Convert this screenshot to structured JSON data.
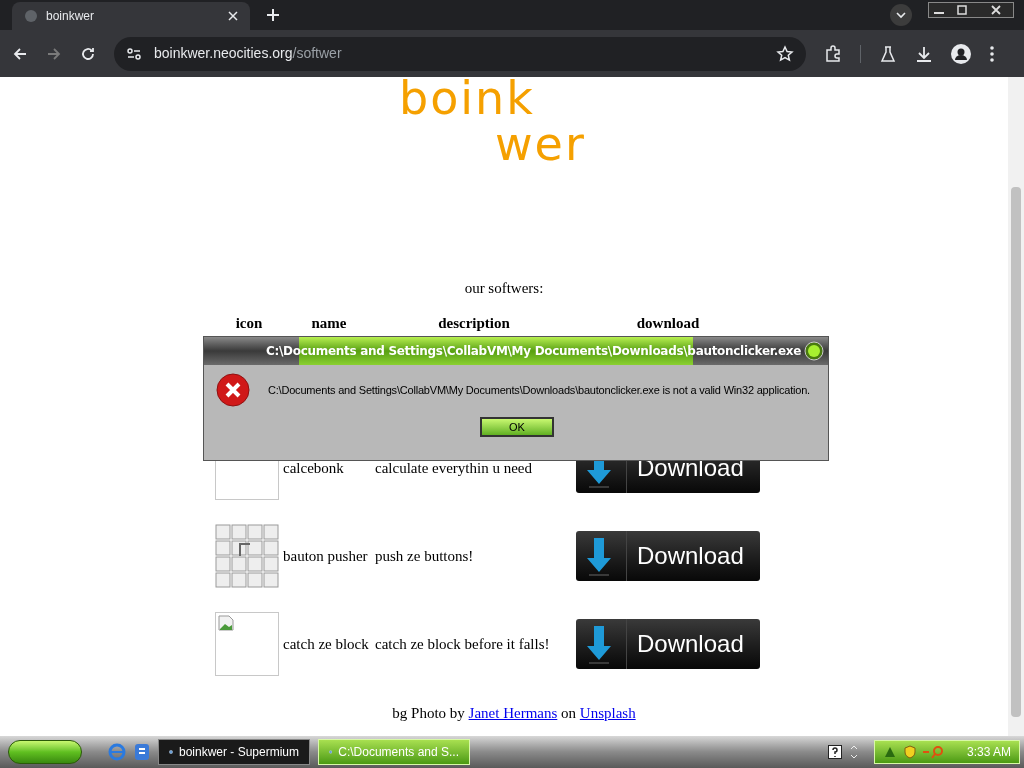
{
  "browser": {
    "tab": {
      "title": "boinkwer"
    },
    "address": {
      "host": "boinkwer.neocities.org",
      "path": "/softwer"
    }
  },
  "page": {
    "logo": {
      "line_1": "boink",
      "line_2": "wer"
    },
    "heading": "our softwers:",
    "table": {
      "columns": [
        "icon",
        "name",
        "description",
        "download"
      ],
      "rows": [
        {
          "kind": "blank",
          "name": "calcebonk",
          "description": "calculate everythin u need",
          "download": "Download"
        },
        {
          "kind": "grid",
          "name": "bauton pusher",
          "description": "push ze buttons!",
          "download": "Download"
        },
        {
          "kind": "broken",
          "name": "catch ze block",
          "description": "catch ze block before it falls!",
          "download": "Download"
        }
      ]
    },
    "credit": {
      "prefix": "bg Photo by",
      "author": "Janet Hermans",
      "middle": "on",
      "site": "Unsplash"
    }
  },
  "dialog": {
    "title": "C:\\Documents and Settings\\CollabVM\\My Documents\\Downloads\\bautonclicker.exe",
    "message": "C:\\Documents and Settings\\CollabVM\\My Documents\\Downloads\\bautonclicker.exe is not a valid Win32 application.",
    "button": "OK"
  },
  "taskbar": {
    "tasks": [
      {
        "label": "boinkwer - Supermium",
        "selected": false
      },
      {
        "label": "C:\\Documents and S...",
        "selected": true
      }
    ],
    "clock": "3:33 AM"
  }
}
